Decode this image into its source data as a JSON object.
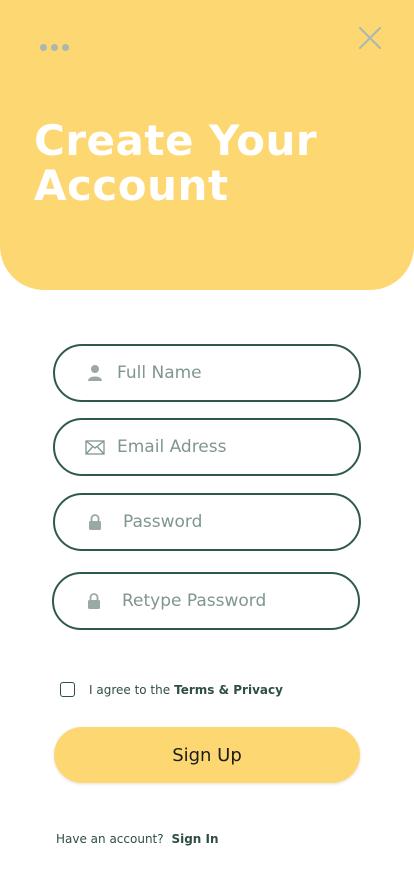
{
  "header": {
    "title": "Create Your Account",
    "background_color": "#fdd771",
    "menu_icon": "more-dots-icon",
    "close_icon": "close-icon"
  },
  "form": {
    "full_name": {
      "placeholder": "Full Name",
      "value": "",
      "icon": "person-icon"
    },
    "email": {
      "placeholder": "Email Adress",
      "value": "",
      "icon": "envelope-icon"
    },
    "password": {
      "placeholder": "Password",
      "value": "",
      "icon": "lock-icon"
    },
    "retype_password": {
      "placeholder": "Retype Password",
      "value": "",
      "icon": "lock-icon"
    },
    "border_color": "#2f5a4b"
  },
  "terms": {
    "checked": false,
    "prefix": "I agree to the",
    "link": "Terms & Privacy"
  },
  "signup": {
    "label": "Sign Up",
    "color": "#fdd771"
  },
  "footer": {
    "prompt": "Have an account?",
    "link": "Sign In"
  }
}
